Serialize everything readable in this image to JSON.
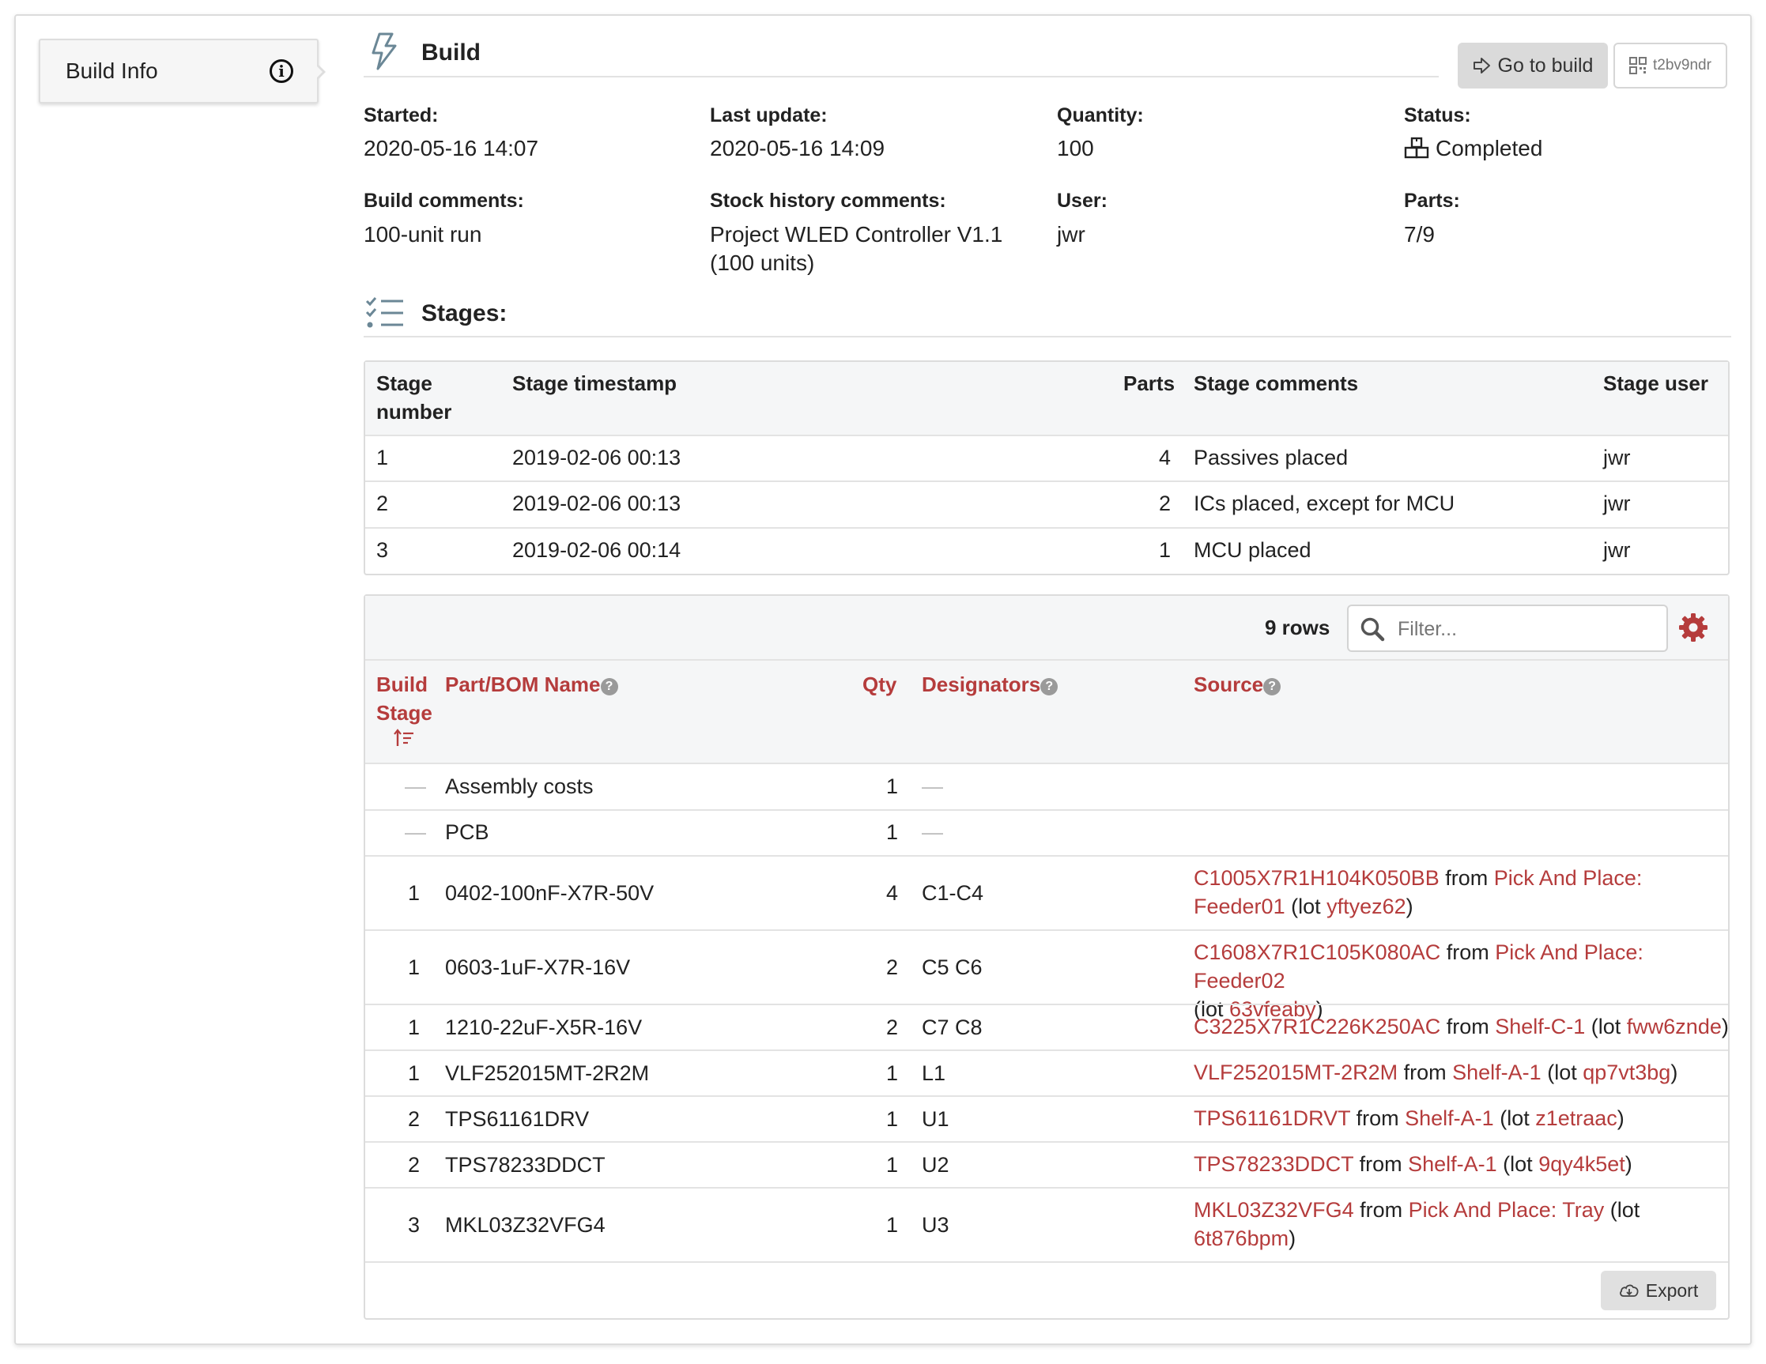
{
  "sidebar": {
    "tab_label": "Build Info"
  },
  "header": {
    "title": "Build",
    "goto_label": "Go to build",
    "qr_label": "t2bv9ndr"
  },
  "info": {
    "started_label": "Started:",
    "started": "2020-05-16 14:07",
    "last_update_label": "Last update:",
    "last_update": "2020-05-16 14:09",
    "quantity_label": "Quantity:",
    "quantity": "100",
    "status_label": "Status:",
    "status": "Completed",
    "build_comments_label": "Build comments:",
    "build_comments": "100-unit run",
    "stock_comments_label": "Stock history comments:",
    "stock_comments_1": "Project WLED Controller V1.1",
    "stock_comments_2": "(100 units)",
    "user_label": "User:",
    "user": "jwr",
    "parts_label": "Parts:",
    "parts": "7/9"
  },
  "stages": {
    "title": "Stages:",
    "headers": {
      "number_1": "Stage",
      "number_2": "number",
      "timestamp": "Stage timestamp",
      "parts": "Parts",
      "comments": "Stage comments",
      "user": "Stage user"
    },
    "rows": [
      {
        "number": "1",
        "timestamp": "2019-02-06 00:13",
        "parts": "4",
        "comments": "Passives placed",
        "user": "jwr"
      },
      {
        "number": "2",
        "timestamp": "2019-02-06 00:13",
        "parts": "2",
        "comments": "ICs placed, except for MCU",
        "user": "jwr"
      },
      {
        "number": "3",
        "timestamp": "2019-02-06 00:14",
        "parts": "1",
        "comments": "MCU placed",
        "user": "jwr"
      }
    ]
  },
  "bom": {
    "row_count": "9 rows",
    "filter_placeholder": "Filter...",
    "headers": {
      "stage_1": "Build",
      "stage_2": "Stage",
      "part": "Part/BOM Name",
      "qty": "Qty",
      "designators": "Designators",
      "source": "Source"
    },
    "dash": "—",
    "rows": [
      {
        "stage": "—",
        "part": "Assembly costs",
        "qty": "1",
        "designators": "—"
      },
      {
        "stage": "—",
        "part": "PCB",
        "qty": "1",
        "designators": "—"
      },
      {
        "stage": "1",
        "part": "0402-100nF-X7R-50V",
        "qty": "4",
        "designators": "C1-C4",
        "src_part": "C1005X7R1H104K050BB",
        "src_from": " from ",
        "src_loc": "Pick And Place:",
        "src_loc2": "Feeder01",
        "src_lot_pre": " (lot ",
        "src_lot": "yftyez62",
        "src_close": ")"
      },
      {
        "stage": "1",
        "part": "0603-1uF-X7R-16V",
        "qty": "2",
        "designators": "C5 C6",
        "src_part": "C1608X7R1C105K080AC",
        "src_from": " from ",
        "src_loc": "Pick And Place: Feeder02",
        "src_lot_pre": "(lot ",
        "src_lot": "63vfeaby",
        "src_close": ")"
      },
      {
        "stage": "1",
        "part": "1210-22uF-X5R-16V",
        "qty": "2",
        "designators": "C7 C8",
        "src_part": "C3225X7R1C226K250AC",
        "src_from": " from ",
        "src_loc": "Shelf-C-1",
        "src_lot_pre": " (lot ",
        "src_lot": "fww6znde",
        "src_close": ")"
      },
      {
        "stage": "1",
        "part": "VLF252015MT-2R2M",
        "qty": "1",
        "designators": "L1",
        "src_part": "VLF252015MT-2R2M",
        "src_from": " from ",
        "src_loc": "Shelf-A-1",
        "src_lot_pre": " (lot ",
        "src_lot": "qp7vt3bg",
        "src_close": ")"
      },
      {
        "stage": "2",
        "part": "TPS61161DRV",
        "qty": "1",
        "designators": "U1",
        "src_part": "TPS61161DRVT",
        "src_from": " from ",
        "src_loc": "Shelf-A-1",
        "src_lot_pre": " (lot ",
        "src_lot": "z1etraac",
        "src_close": ")"
      },
      {
        "stage": "2",
        "part": "TPS78233DDCT",
        "qty": "1",
        "designators": "U2",
        "src_part": "TPS78233DDCT",
        "src_from": " from ",
        "src_loc": "Shelf-A-1",
        "src_lot_pre": " (lot ",
        "src_lot": "9qy4k5et",
        "src_close": ")"
      },
      {
        "stage": "3",
        "part": "MKL03Z32VFG4",
        "qty": "1",
        "designators": "U3",
        "src_part": "MKL03Z32VFG4",
        "src_from": " from ",
        "src_loc": "Pick And Place: Tray",
        "src_lot_pre": " (lot",
        "src_lot": "6t876bpm",
        "src_close": ")"
      }
    ],
    "export_label": "Export"
  },
  "colors": {
    "accent": "#b53c3c",
    "border": "#dcdcdc",
    "header_bg": "#f5f6f7"
  }
}
